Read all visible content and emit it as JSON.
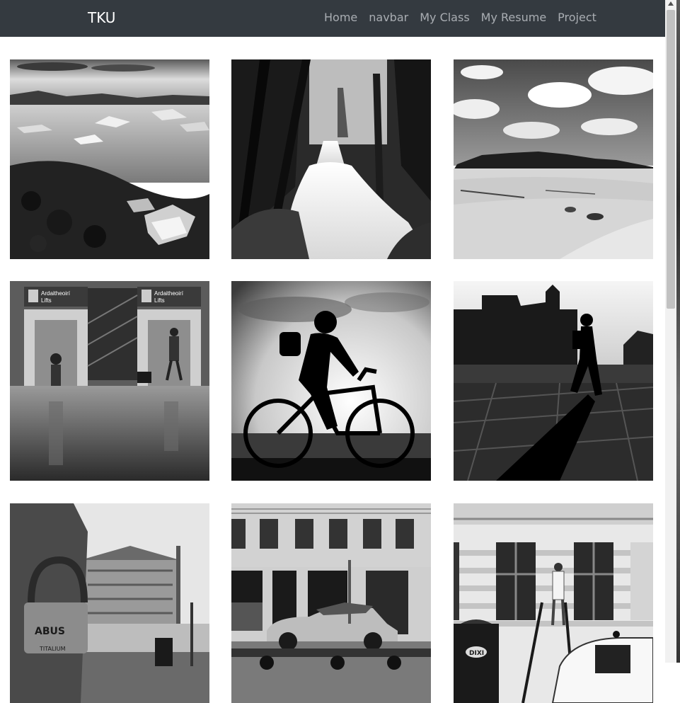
{
  "navbar": {
    "brand": "TKU",
    "links": [
      "Home",
      "navbar",
      "My Class",
      "My Resume",
      "Project"
    ]
  },
  "photos": [
    {
      "subject": "glacier-lagoon"
    },
    {
      "subject": "forest-waterfall"
    },
    {
      "subject": "desert-dunes"
    },
    {
      "subject": "airport-lifts",
      "signs": [
        "Ardaitheoirí",
        "Lifts"
      ]
    },
    {
      "subject": "cyclist-silhouette"
    },
    {
      "subject": "pedestrian-shadow"
    },
    {
      "subject": "padlock-street",
      "lock_text": [
        "ABUS",
        "TITALIUM"
      ]
    },
    {
      "subject": "vintage-car"
    },
    {
      "subject": "window-cleaner",
      "bin_text": "DIXI"
    }
  ],
  "colors": {
    "navbar_bg": "#343a40",
    "brand": "#ffffff",
    "link": "#a9adb2"
  }
}
